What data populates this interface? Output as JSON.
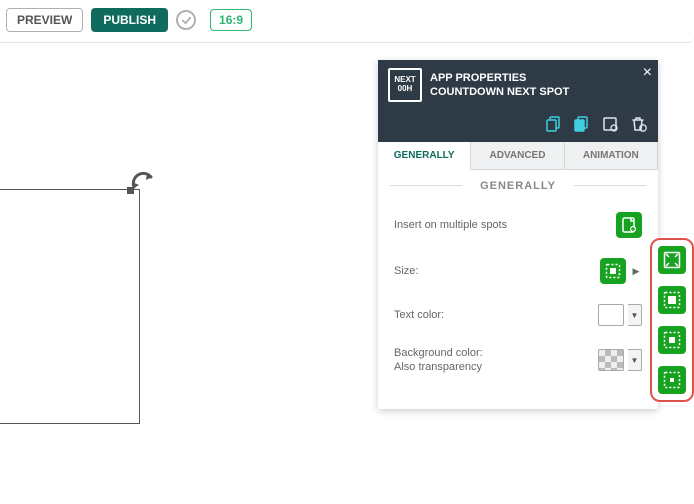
{
  "topbar": {
    "preview_label": "PREVIEW",
    "publish_label": "PUBLISH",
    "aspect_label": "16:9"
  },
  "panel": {
    "title1": "APP PROPERTIES",
    "title2": "COUNTDOWN NEXT SPOT",
    "logo_top": "NEXT",
    "logo_bottom": "00H",
    "tabs": {
      "general": "GENERALLY",
      "advanced": "ADVANCED",
      "animation": "ANIMATION"
    },
    "section_label": "GENERALLY",
    "rows": {
      "insert_multi": "Insert on multiple spots",
      "size": "Size:",
      "text_color": "Text color:",
      "bg_color_l1": "Background color:",
      "bg_color_l2": "Also transparency"
    }
  }
}
